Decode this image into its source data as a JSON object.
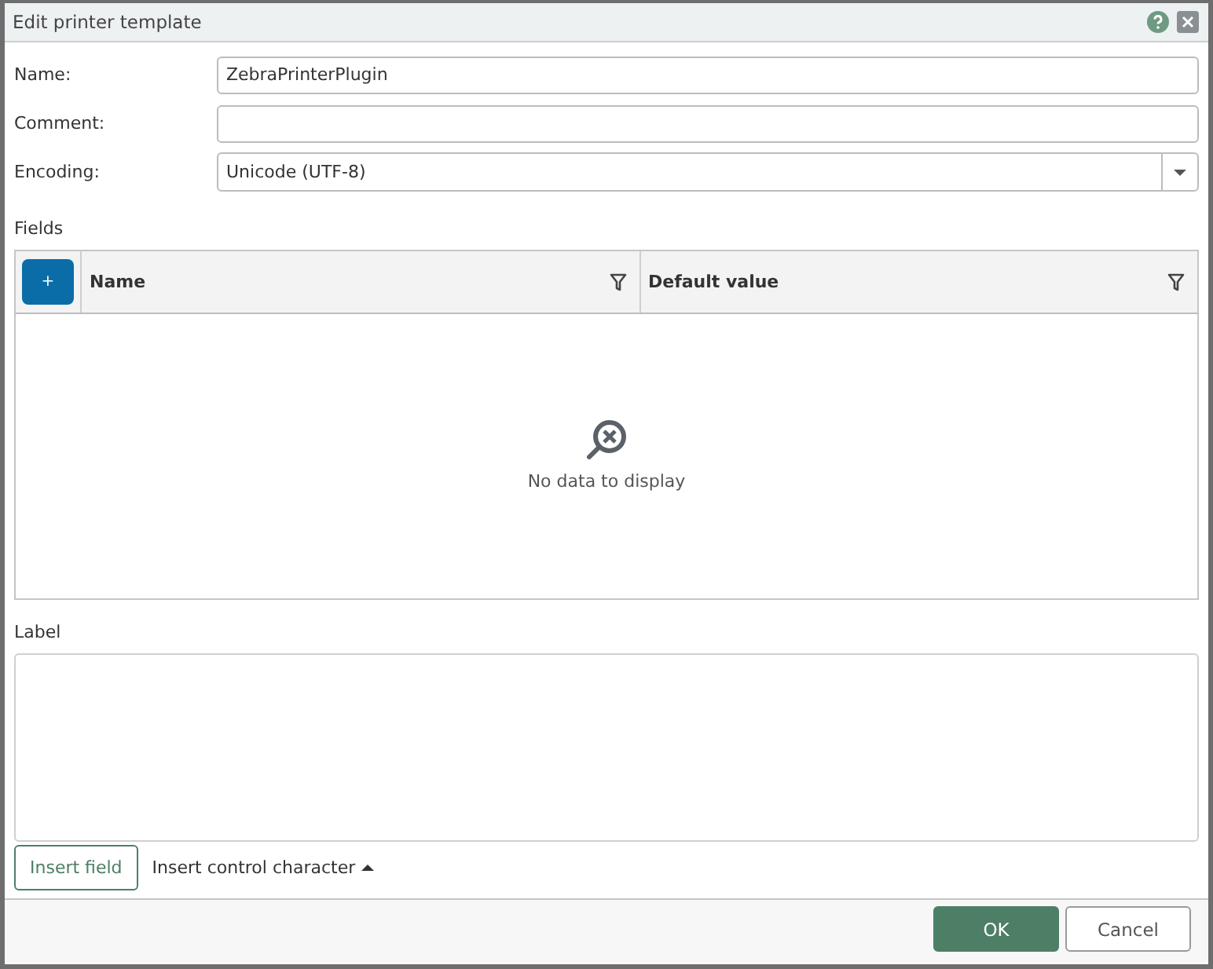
{
  "window": {
    "title": "Edit printer template"
  },
  "form": [
    {
      "kind": "text",
      "label": "Name:",
      "value": "ZebraPrinterPlugin"
    },
    {
      "kind": "text",
      "label": "Comment:"
    },
    {
      "kind": "select",
      "label": "Encoding:",
      "value": "Unicode (UTF-8)"
    }
  ],
  "fields": {
    "title": "Fields",
    "add_button": "+",
    "columns": [
      "Name",
      "Default value"
    ],
    "empty_text": "No data to display"
  },
  "label": {
    "title": "Label"
  },
  "label_actions": {
    "insert_field": "Insert field",
    "insert_control_character": "Insert control character"
  },
  "buttons": [
    {
      "kind": "primary",
      "text": "OK"
    },
    {
      "kind": "secondary",
      "text": "Cancel"
    }
  ]
}
